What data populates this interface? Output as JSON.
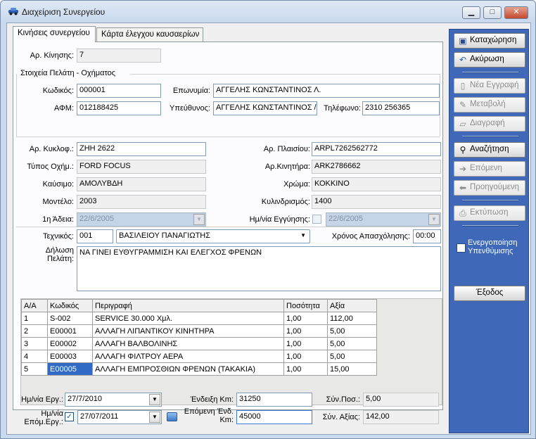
{
  "window": {
    "title": "Διαχείριση Συνεργείου",
    "controls": {
      "minimize": "▁",
      "maximize": "□",
      "close": "✕"
    }
  },
  "tabs": [
    {
      "label": "Κινήσεις συνεργείου",
      "active": true
    },
    {
      "label": "Κάρτα έλεγχου καυσαερίων",
      "active": false
    }
  ],
  "movement": {
    "label": "Αρ. Κίνησης:",
    "value": "7"
  },
  "customer_group": {
    "title": "Στοιχεία Πελάτη - Οχήματος"
  },
  "customer": {
    "code_label": "Κωδικός:",
    "code": "000001",
    "name_label": "Επωνυμία:",
    "name": "ΑΓΓΕΛΗΣ ΚΩΝΣΤΑΝΤΙΝΟΣ Λ.",
    "afm_label": "ΑΦΜ:",
    "afm": "012188425",
    "responsible_label": "Υπεύθυνος:",
    "responsible": "ΑΓΓΕΛΗΣ ΚΩΝΣΤΑΝΤΙΝΟΣ /",
    "phone_label": "Τηλέφωνο:",
    "phone": "2310 256365"
  },
  "vehicle": {
    "plate_label": "Αρ. Κυκλοφ.:",
    "plate": "ΖΗΗ 2622",
    "chassis_label": "Αρ. Πλαισίου:",
    "chassis": "ARPL7262562772",
    "type_label": "Τύπος Οχήμ.:",
    "type": "FORD FOCUS",
    "engine_label": "Αρ.Κινητήρα:",
    "engine": "ARK2786662",
    "fuel_label": "Καύσιμο:",
    "fuel": "ΑΜΟΛΥΒΔΗ",
    "color_label": "Χρώμα:",
    "color": "ΚΟΚΚΙΝΟ",
    "model_label": "Μοντέλο:",
    "model": "2003",
    "cc_label": "Κυλινδρισμός:",
    "cc": "1400",
    "license_label": "1η Άδεια:",
    "license": "22/6/2005",
    "warranty_label": "Ημ/νία Εγγύησης:",
    "warranty": "22/6/2005"
  },
  "technician": {
    "label": "Τεχνικός:",
    "code": "001",
    "name": "ΒΑΣΙΛΕΙΟΥ ΠΑΝΑΓΙΩΤΗΣ",
    "time_label": "Χρόνος Απασχόλησης:",
    "time": "00:00"
  },
  "declaration": {
    "label_line1": "Δήλωση",
    "label_line2": "Πελάτη:",
    "text": "ΝΑ ΓΙΝΕΙ ΕΥΘΥΓΡΑΜΜΙΣΗ ΚΑΙ ΕΛΕΓΧΟΣ ΦΡΕΝΩΝ"
  },
  "grid": {
    "headers": [
      "Α/Α",
      "Κωδικός",
      "Περιγραφή",
      "Ποσότητα",
      "Αξία"
    ],
    "rows": [
      [
        "1",
        "S-002",
        "SERVICE 30.000 Χμλ.",
        "1,00",
        "112,00"
      ],
      [
        "2",
        "E00001",
        "ΑΛΛΑΓΗ ΛΙΠΑΝΤΙΚΟΥ ΚΙΝΗΤΗΡΑ",
        "1,00",
        "5,00"
      ],
      [
        "3",
        "E00002",
        "ΑΛΛΑΓΗ ΒΑΛΒΟΛΙΝΗΣ",
        "1,00",
        "5,00"
      ],
      [
        "4",
        "E00003",
        "ΑΛΛΑΓΗ ΦΙΛΤΡΟΥ ΑΕΡΑ",
        "1,00",
        "5,00"
      ],
      [
        "5",
        "E00005",
        "ΑΛΛΑΓΗ ΕΜΠΡΟΣΘΙΩΝ ΦΡΕΝΩΝ (ΤΑΚΑΚΙΑ)",
        "1,00",
        "15,00"
      ]
    ]
  },
  "footer": {
    "work_date_label": "Ημ/νία Εργ.:",
    "work_date": "27/7/2010",
    "next_date_label_line1": "Ημ/νία",
    "next_date_label_line2": "Επόμ.Εργ.:",
    "next_date": "27/07/2011",
    "km_label": "Ένδειξη Km:",
    "km": "31250",
    "next_km_label_line1": "Επόμενη Ένδ.",
    "next_km_label_line2": "Km:",
    "next_km": "45000",
    "total_qty_label": "Σύν.Ποσ.:",
    "total_qty": "5,00",
    "total_value_label": "Σύν. Αξίας:",
    "total_value": "142,00"
  },
  "sidebar": {
    "save": "Καταχώρηση",
    "cancel": "Ακύρωση",
    "new": "Νέα Εγγραφή",
    "edit": "Μεταβολή",
    "delete": "Διαγραφή",
    "search": "Αναζήτηση",
    "next": "Επόμενη",
    "prev": "Προηγούμενη",
    "print": "Εκτύπωση",
    "reminder_line1": "Ενεργοποίηση",
    "reminder_line2": "Υπενθύμισης",
    "exit": "Έξοδος"
  }
}
